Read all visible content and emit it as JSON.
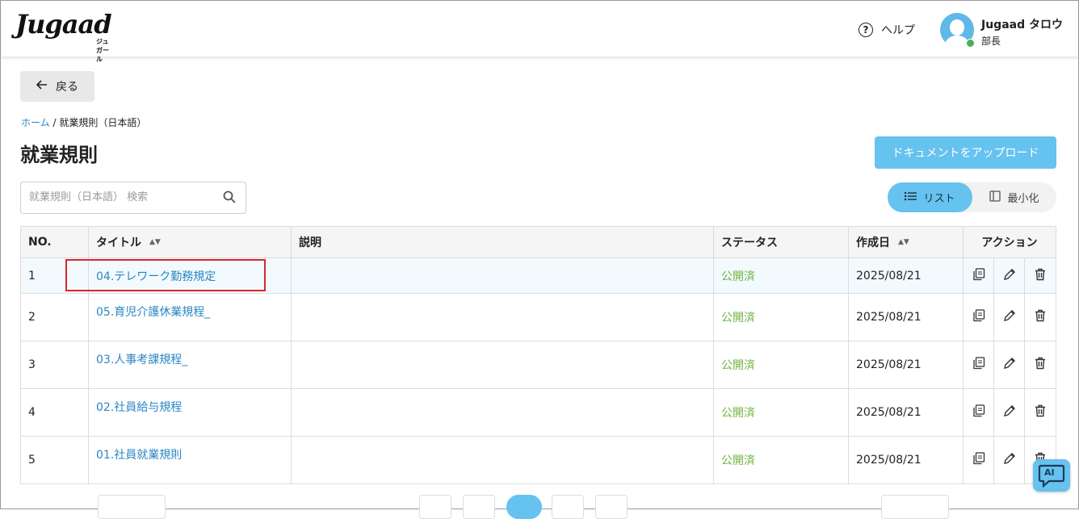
{
  "header": {
    "logo_text": "Jugaad",
    "logo_sub": "ジュガール",
    "help_label": "ヘルプ",
    "user_name": "Jugaad タロウ",
    "user_role": "部長"
  },
  "nav": {
    "back_label": "戻る"
  },
  "breadcrumb": {
    "home": "ホーム",
    "separator": "/",
    "current": "就業規則（日本語）"
  },
  "page": {
    "title": "就業規則",
    "upload_label": "ドキュメントをアップロード"
  },
  "search": {
    "placeholder": "就業規則（日本語） 検索",
    "value": ""
  },
  "view": {
    "list_label": "リスト",
    "min_label": "最小化",
    "selected": "リスト"
  },
  "table": {
    "headers": {
      "no": "NO.",
      "title": "タイトル",
      "desc": "説明",
      "status": "ステータス",
      "date": "作成日",
      "actions": "アクション"
    },
    "rows": [
      {
        "no": "1",
        "title": "04.テレワーク勤務規定",
        "desc": "",
        "status": "公開済",
        "date": "2025/08/21"
      },
      {
        "no": "2",
        "title": "05.育児介護休業規程_",
        "desc": "",
        "status": "公開済",
        "date": "2025/08/21"
      },
      {
        "no": "3",
        "title": "03.人事考課規程_",
        "desc": "",
        "status": "公開済",
        "date": "2025/08/21"
      },
      {
        "no": "4",
        "title": "02.社員給与規程",
        "desc": "",
        "status": "公開済",
        "date": "2025/08/21"
      },
      {
        "no": "5",
        "title": "01.社員就業規則",
        "desc": "",
        "status": "公開済",
        "date": "2025/08/21"
      }
    ]
  },
  "ai": {
    "label": "AI"
  },
  "colors": {
    "accent": "#66c2ef",
    "link": "#2a86c3",
    "status_published": "#6db33f",
    "highlight": "#d9262c"
  }
}
